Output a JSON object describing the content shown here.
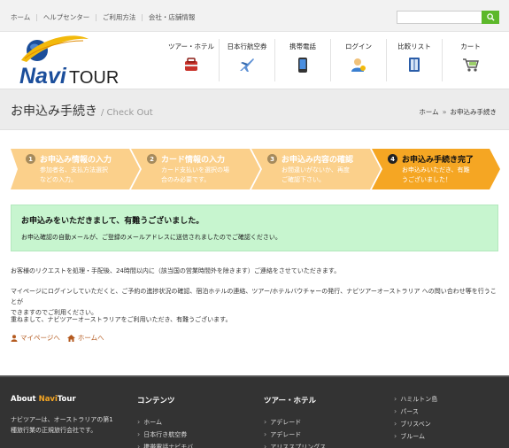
{
  "topbar": {
    "links": [
      "ホーム",
      "ヘルプセンター",
      "ご利用方法",
      "会社・店舗情報"
    ],
    "search_placeholder": "",
    "search_icon": "search-icon"
  },
  "logo": {
    "text_navi": "Navi",
    "text_tour": "TOUR"
  },
  "nav": [
    {
      "label": "ツアー・ホテル",
      "icon": "hotel-icon"
    },
    {
      "label": "日本行航空券",
      "icon": "airplane-icon"
    },
    {
      "label": "携帯電話",
      "icon": "mobile-phone-icon"
    },
    {
      "label": "ログイン",
      "icon": "login-user-icon"
    },
    {
      "label": "比較リスト",
      "icon": "compare-list-icon"
    },
    {
      "label": "カート",
      "icon": "cart-icon"
    }
  ],
  "page": {
    "title": "お申込み手続き",
    "subtitle": "/ Check Out",
    "breadcrumb": {
      "home": "ホーム",
      "current": "お申込み手続き"
    }
  },
  "steps": [
    {
      "num": "1",
      "title": "お申込み情報の入力",
      "desc": [
        "参加者名、支払方法選択",
        "などの入力。"
      ],
      "active": false
    },
    {
      "num": "2",
      "title": "カード情報の入力",
      "desc": [
        "カード支払いを選択の場",
        "合のみ必要です。"
      ],
      "active": false
    },
    {
      "num": "3",
      "title": "お申込み内容の確認",
      "desc": [
        "お間違いがないか、再度",
        "ご確認下さい。"
      ],
      "active": false
    },
    {
      "num": "4",
      "title": "お申込み手続き完了",
      "desc": [
        "お申込みいただき、有難",
        "うございました！"
      ],
      "active": true
    }
  ],
  "alert": {
    "heading": "お申込みをいただきまして、有難うございました。",
    "message": "お申込確認の自動メールが、ご登録のメールアドレスに送信されましたのでご確認ください。"
  },
  "body": {
    "p1": "お客様のリクエストを処理・手配後、24時間以内に（該当国の営業時間外を除きます）ご連絡をさせていただきます。",
    "p2_line1": "マイページにログインしていただくと、ご予約の進捗状況の確認、宿泊ホテルの連絡、ツアー/ホテルバウチャーの発行、ナビツアーオーストラリア への問い合わせ等を行うことが",
    "p2_line2": "できますのでご利用ください。",
    "p3": "重ねまして、ナビツアーオーストラリアをご利用いただき、有難うございます。",
    "link_mypage": "マイページへ",
    "link_home": "ホームへ"
  },
  "footer": {
    "about_prefix": "About ",
    "about_navi": "Navi",
    "about_tour": "Tour",
    "about_text": [
      "ナビツアーは、オーストラリアの第1",
      "種旅行業の正規旅行会社です。"
    ],
    "contents_title": "コンテンツ",
    "contents_items": [
      "ホーム",
      "日本行き航空券",
      "携帯電話ナビモバ"
    ],
    "tours_title": "ツアー・ホテル",
    "tours_items": [
      "アデレード",
      "アデレード",
      "アリススプリングス"
    ],
    "cities": [
      "ハミルトン島",
      "パース",
      "ブリスベン",
      "ブルーム"
    ]
  },
  "colors": {
    "step_inactive": "#fbd08b",
    "step_active": "#f5a623",
    "alert_bg": "#c7f5cf",
    "accent_green": "#5cb82a",
    "footer_bg": "#333333",
    "link": "#b45a1f"
  }
}
